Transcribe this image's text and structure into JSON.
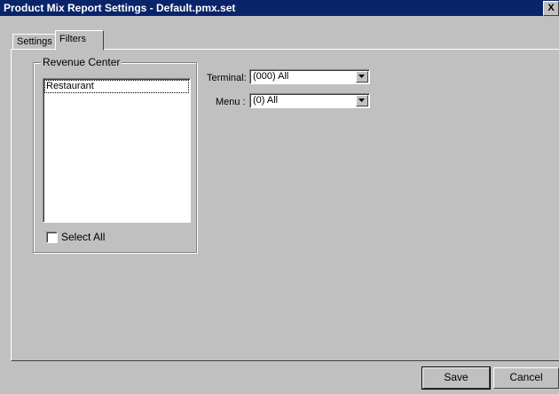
{
  "window": {
    "title": "Product Mix Report Settings - Default.pmx.set",
    "close_glyph": "X"
  },
  "tabs": [
    {
      "label": "Settings",
      "active": false
    },
    {
      "label": "Filters",
      "active": true
    }
  ],
  "revenue_center": {
    "group_label": "Revenue Center",
    "items": [
      "Restaurant"
    ],
    "select_all_label": "Select All",
    "select_all_checked": false
  },
  "filters": {
    "terminal_label": "Terminal:",
    "terminal_value": "(000) All",
    "menu_label": "Menu :",
    "menu_value": "(0) All"
  },
  "buttons": {
    "save_label": "Save",
    "cancel_label": "Cancel"
  },
  "icons": {
    "close": "close-icon",
    "dropdown": "chevron-down-icon"
  }
}
